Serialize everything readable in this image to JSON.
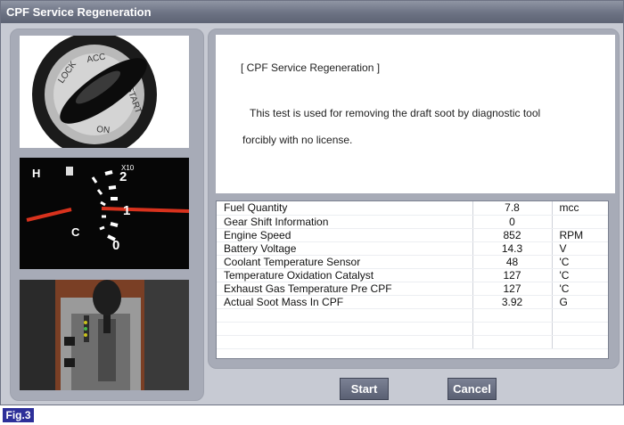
{
  "window": {
    "title": "CPF Service Regeneration"
  },
  "description": {
    "title": "[ CPF Service Regeneration ]",
    "text_line1": "This test is used for removing the draft soot by diagnostic tool",
    "text_line2": "forcibly with no license."
  },
  "images": {
    "ignition": {
      "icon": "ignition-key-photo",
      "text": "LOCK ACC ON START"
    },
    "gauge": {
      "icon": "tachometer-photo",
      "scale_label": "X10",
      "ticks": [
        "2",
        "1",
        "0"
      ],
      "left_labels": [
        "H",
        "C"
      ]
    },
    "shifter": {
      "icon": "gear-shifter-photo"
    }
  },
  "table": {
    "rows": [
      {
        "name": "Fuel Quantity",
        "value": "7.8",
        "unit": "mcc"
      },
      {
        "name": "Gear Shift Information",
        "value": "0",
        "unit": ""
      },
      {
        "name": "Engine Speed",
        "value": "852",
        "unit": "RPM"
      },
      {
        "name": "Battery Voltage",
        "value": "14.3",
        "unit": "V"
      },
      {
        "name": "Coolant Temperature Sensor",
        "value": "48",
        "unit": "'C"
      },
      {
        "name": "Temperature Oxidation Catalyst",
        "value": "127",
        "unit": "'C"
      },
      {
        "name": "Exhaust Gas Temperature Pre CPF",
        "value": "127",
        "unit": "'C"
      },
      {
        "name": "Actual Soot Mass In CPF",
        "value": "3.92",
        "unit": "G"
      }
    ]
  },
  "buttons": {
    "start": "Start",
    "cancel": "Cancel"
  },
  "figure_label": "Fig.3",
  "colors": {
    "titlebar": "#6c7283",
    "panel": "#a7abb7",
    "window_bg": "#c7cad3",
    "button": "#5a6073",
    "figure_label_bg": "#2d2f99",
    "gauge_needle": "#d8321d"
  }
}
